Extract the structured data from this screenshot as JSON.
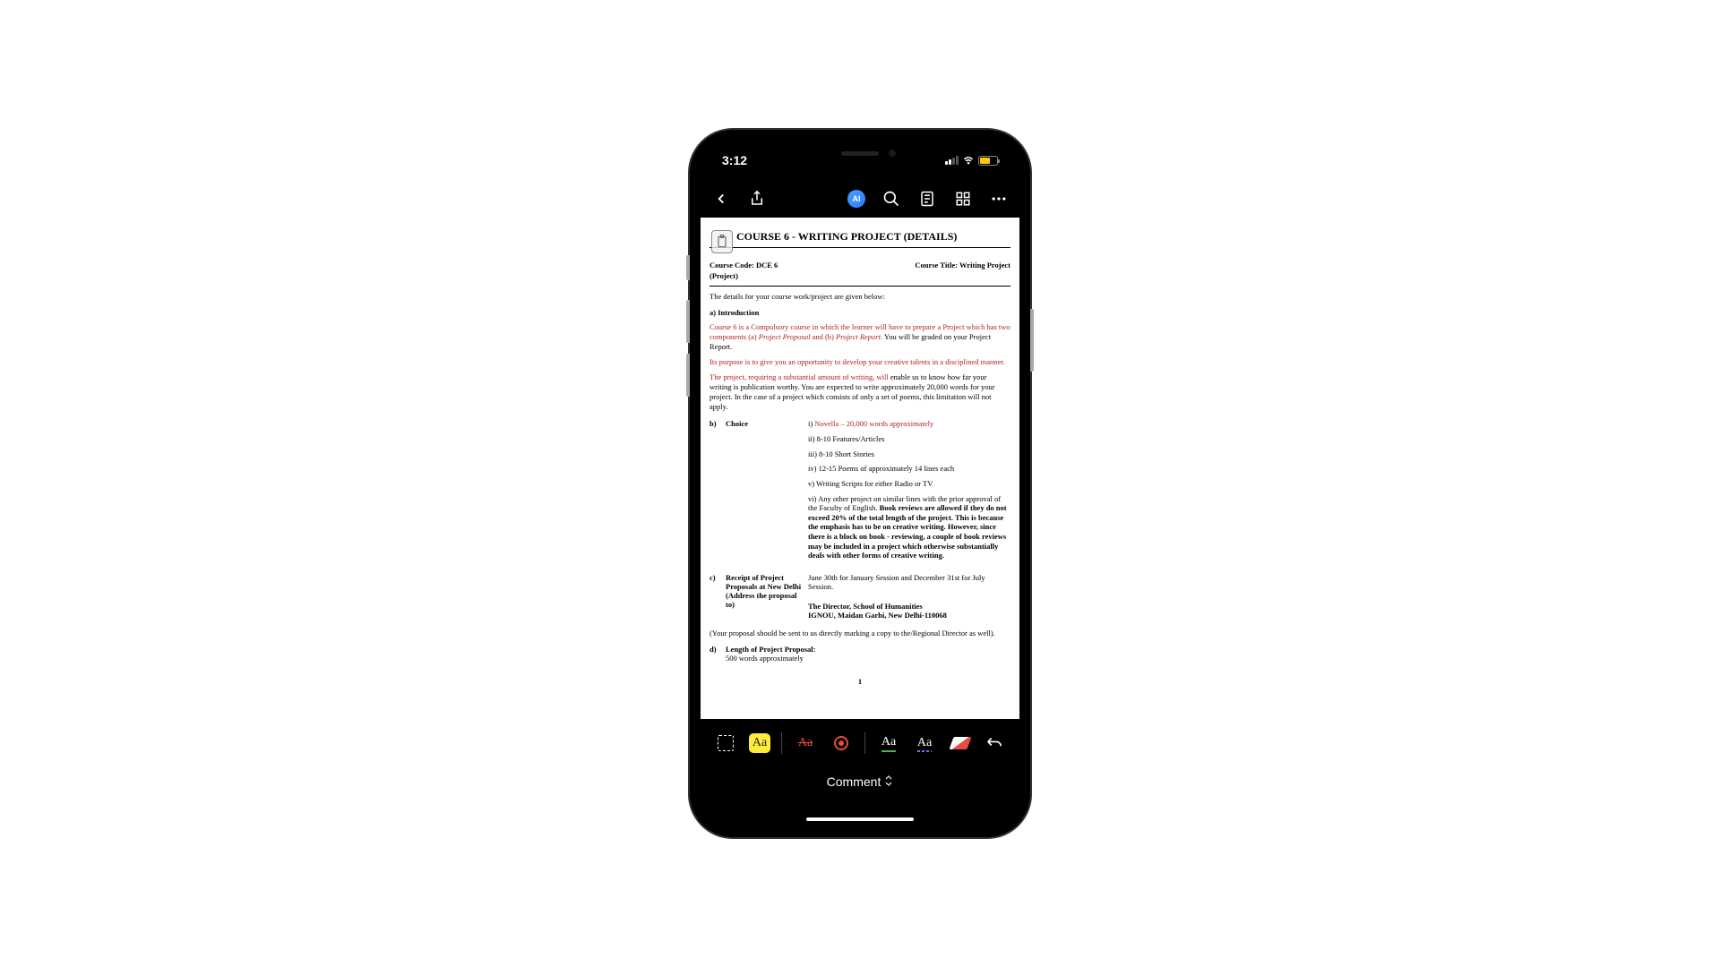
{
  "status": {
    "time": "3:12",
    "battery_color": "#ffcc00"
  },
  "topbar": {
    "ai_label": "AI"
  },
  "doc": {
    "title": "COURSE 6 - WRITING PROJECT (DETAILS)",
    "course_code_label": "Course Code: DCE 6",
    "course_title_label": "Course Title: Writing Project",
    "project_label": "(Project)",
    "details_intro": "The details for your course work/project are given below:",
    "section_a": "a) Introduction",
    "para1_pre": "Course 6 is a Compulsory course in which the learner will have to prepare a Project which has two components (a) ",
    "para1_em1": "Project Proposal",
    "para1_mid": " and (b) ",
    "para1_em2": "Project Report.",
    "para1_post": " You will be graded on your Project Report.",
    "para2": "Its purpose is to give you an opportunity to develop your creative talents in a disciplined manner.",
    "para3_red": "The project, requiring a substantial amount of writing, will",
    "para3_rest": " enable us to know how far your writing is publication worthy. You are expected to write approximately 20,000 words for your project. In the case of a project which consists of only a set of poems, this limitation will not apply.",
    "b_letter": "b)",
    "b_label": "Choice",
    "b_i_pre": "i) ",
    "b_i_red": "Novella – 20,000 words approximately",
    "b_ii": "ii) 8-10 Features/Articles",
    "b_iii": "iii) 8-10 Short Stories",
    "b_iv": "iv) 12-15 Poems of approximately 14 lines each",
    "b_v": "v) Writing Scripts for either Radio or TV",
    "b_vi_pre": "vi) Any other project on similar lines with the prior approval of the Faculty of English. ",
    "b_vi_bold": "Book reviews are allowed if they do not exceed 20% of the total length of the project. This is because the emphasis has to be on creative writing. However, since there is a block on book - reviewing, a couple of book reviews may be included in a project which otherwise substantially deals with other forms of creative writing.",
    "c_letter": "c)",
    "c_label": "Receipt of Project Proposals at New Delhi (Address the proposal to)",
    "c_content": "June 30th for January Session and December 31st for July Session.",
    "c_addr1": "The Director, School of Humanities",
    "c_addr2": "IGNOU, Maidan Garhi, New Delhi-110068",
    "c_note": "(Your proposal should be sent to us directly marking a copy to the/Regional Director as well).",
    "d_letter": "d)",
    "d_label": "Length of Project Proposal:",
    "d_content": "500 words approximately",
    "page_num": "1"
  },
  "tools": {
    "highlight_label": "Aa",
    "strike_label": "Aa",
    "underline_g_label": "Aa",
    "underline_w_label": "Aa"
  },
  "mode": {
    "label": "Comment"
  }
}
